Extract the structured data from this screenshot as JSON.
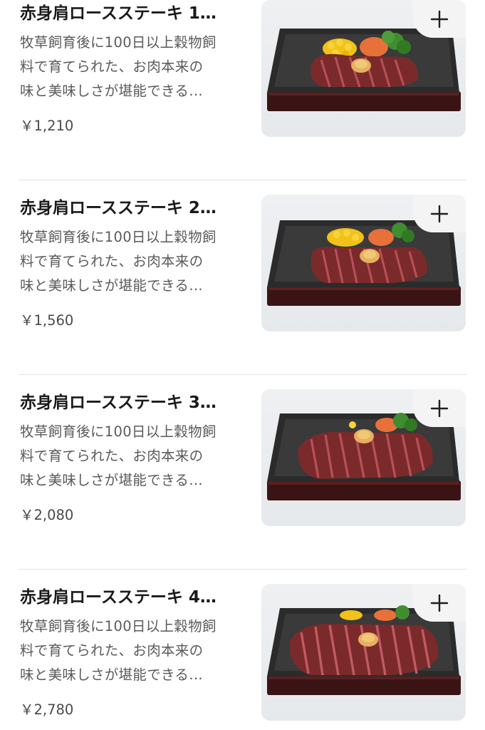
{
  "menu_items": [
    {
      "title": "赤身肩ロースステーキ 1…",
      "desc": [
        "牧草飼育後に100日以上穀物飼",
        "料で育てられた、お肉本来の",
        "味と美味しさが堪能できる…"
      ],
      "price": "￥1,210",
      "add_icon": "plus-icon"
    },
    {
      "title": "赤身肩ロースステーキ 2…",
      "desc": [
        "牧草飼育後に100日以上穀物飼",
        "料で育てられた、お肉本来の",
        "味と美味しさが堪能できる…"
      ],
      "price": "￥1,560",
      "add_icon": "plus-icon"
    },
    {
      "title": "赤身肩ロースステーキ 3…",
      "desc": [
        "牧草飼育後に100日以上穀物飼",
        "料で育てられた、お肉本来の",
        "味と美味しさが堪能できる…"
      ],
      "price": "￥2,080",
      "add_icon": "plus-icon"
    },
    {
      "title": "赤身肩ロースステーキ 4…",
      "desc": [
        "牧草飼育後に100日以上穀物飼",
        "料で育てられた、お肉本来の",
        "味と美味しさが堪能できる…"
      ],
      "price": "￥2,780",
      "add_icon": "plus-icon"
    }
  ],
  "colors": {
    "title": "#1a1a1a",
    "desc": "#5a5a5a",
    "price": "#4a4a4a",
    "divider": "#e2e2e2",
    "add_button_bg": "#f4f4f4"
  }
}
